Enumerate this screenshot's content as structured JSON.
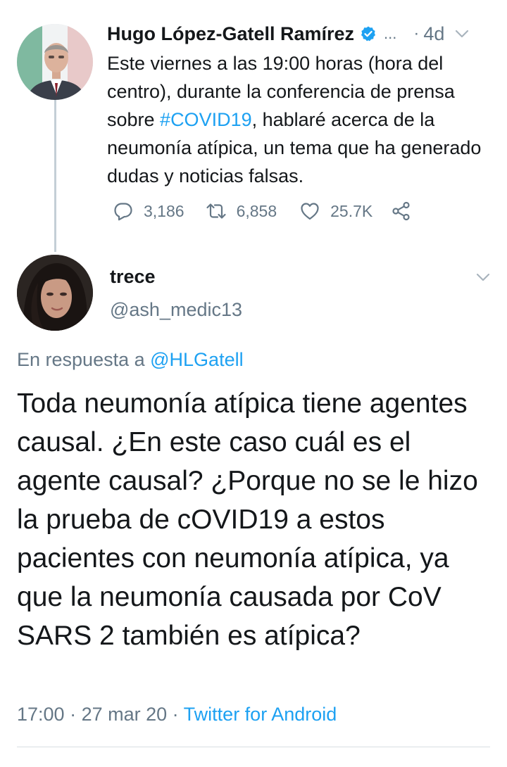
{
  "original_tweet": {
    "author_name": "Hugo López-Gatell Ramírez",
    "ellipsis": "...",
    "separator": "·",
    "time": "4d",
    "text_before_hashtag": "Este viernes a las 19:00 horas (hora del centro), durante la conferencia de prensa sobre ",
    "hashtag": "#COVID19",
    "text_after_hashtag": ", hablaré acerca de la neumonía atípica, un tema que ha generado dudas y noticias falsas.",
    "replies": "3,186",
    "retweets": "6,858",
    "likes": "25.7K"
  },
  "reply_tweet": {
    "author_name": "trece",
    "handle": "@ash_medic13",
    "in_reply_label": "En respuesta a ",
    "in_reply_handle": "@HLGatell",
    "text": "Toda neumonía atípica tiene agentes causal. ¿En este caso cuál es el agente causal? ¿Porque no se le hizo la prueba de cOVID19 a estos pacientes con neumonía atípica, ya que la neumonía causada por CoV SARS 2 también es atípica?",
    "time": "17:00",
    "separator_1": " · ",
    "date": "27 mar 20",
    "separator_2": " · ",
    "client": "Twitter for Android"
  },
  "colors": {
    "accent": "#1da1f2",
    "secondary_text": "#657786",
    "primary_text": "#14171a",
    "thread_line": "#c4cfd6"
  },
  "icons": [
    "verified-badge-icon",
    "chevron-down-icon",
    "reply-icon",
    "retweet-icon",
    "like-icon",
    "share-icon"
  ]
}
